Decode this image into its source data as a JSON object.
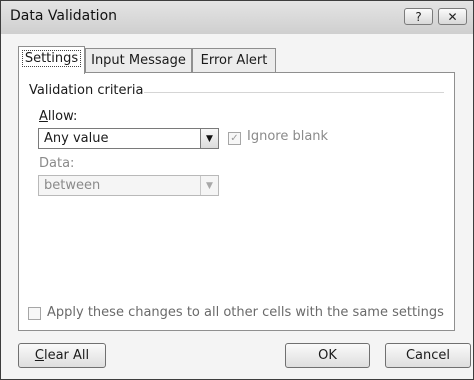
{
  "window": {
    "title": "Data Validation",
    "help_glyph": "?",
    "close_glyph": "✕"
  },
  "tabs": [
    {
      "label": "Settings",
      "active": true
    },
    {
      "label": "Input Message",
      "active": false
    },
    {
      "label": "Error Alert",
      "active": false
    }
  ],
  "settings": {
    "group_title": "Validation criteria",
    "allow": {
      "label_accel": "A",
      "label_rest": "llow:",
      "value": "Any value",
      "enabled": true
    },
    "ignore_blank": {
      "label": "Ignore blank",
      "checked": true,
      "enabled": false
    },
    "data": {
      "label": "Data:",
      "value": "between",
      "enabled": false
    },
    "apply_all": {
      "label": "Apply these changes to all other cells with the same settings",
      "checked": false,
      "enabled": false
    }
  },
  "buttons": {
    "clear_all_accel": "C",
    "clear_all_rest": "lear All",
    "ok": "OK",
    "cancel": "Cancel"
  },
  "icons": {
    "dropdown": "chevron-down-icon",
    "check": "check-icon"
  }
}
